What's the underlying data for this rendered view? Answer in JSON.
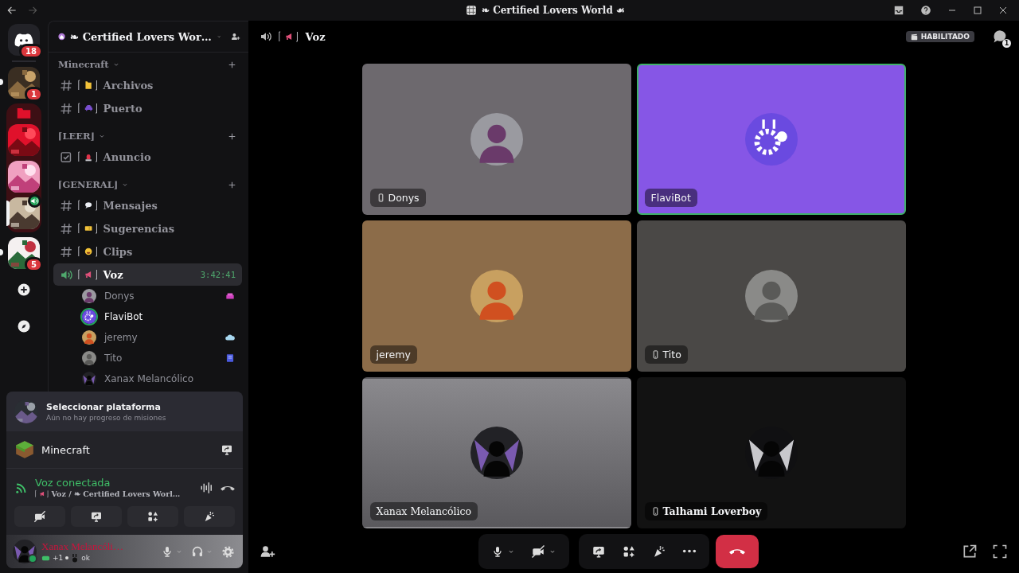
{
  "title_bar": {
    "title": "❧ Certified Lovers World ☙"
  },
  "servers": [
    {
      "kind": "home",
      "badge": "18",
      "selected": false,
      "unread": false,
      "in_voice": false
    },
    {
      "kind": "server",
      "badge": "1",
      "selected": false,
      "unread": true,
      "in_voice": false
    },
    {
      "kind": "folder",
      "children": [
        {
          "kind": "server",
          "selected": false,
          "unread": false,
          "in_voice": false
        },
        {
          "kind": "server",
          "selected": false,
          "unread": false,
          "in_voice": false
        },
        {
          "kind": "server",
          "selected": true,
          "unread": false,
          "in_voice": true
        }
      ]
    },
    {
      "kind": "server",
      "badge": "5",
      "selected": false,
      "unread": true,
      "in_voice": false
    },
    {
      "kind": "add"
    },
    {
      "kind": "discover"
    }
  ],
  "server_header": {
    "name": "❧ Certified Lovers Wor…"
  },
  "categories": [
    {
      "name": "Minecraft",
      "expanded": true,
      "channels": [
        {
          "kind": "text",
          "name": "Archivos",
          "selected": false
        },
        {
          "kind": "text",
          "name": "Puerto",
          "selected": false
        }
      ]
    },
    {
      "name": "⌈LEER⌋",
      "expanded": true,
      "channels": [
        {
          "kind": "announcement",
          "name": "Anuncio",
          "selected": false
        }
      ]
    },
    {
      "name": "⌈GENERAL⌋",
      "expanded": true,
      "channels": [
        {
          "kind": "text",
          "name": "Mensajes",
          "selected": false
        },
        {
          "kind": "text",
          "name": "Sugerencias",
          "selected": false
        },
        {
          "kind": "text",
          "name": "Clips",
          "selected": false
        },
        {
          "kind": "voice",
          "name": "Voz",
          "selected": true,
          "timer": "3:42:41",
          "members": [
            {
              "name": "Donys",
              "speaking": false
            },
            {
              "name": "FlaviBot",
              "speaking": true
            },
            {
              "name": "jeremy",
              "speaking": false
            },
            {
              "name": "Tito",
              "speaking": false
            },
            {
              "name": "Xanax Melancólico",
              "speaking": false
            }
          ]
        }
      ]
    }
  ],
  "panel": {
    "quest": {
      "title": "Seleccionar plataforma",
      "subtitle": "Aún no hay progreso de misiones"
    },
    "game": {
      "name": "Minecraft"
    },
    "voice": {
      "status": "Voz conectada",
      "location": "Voz / ❧ Certified Lovers Worl…"
    },
    "user": {
      "name": "Xanax Melancóli…",
      "extra": "+1",
      "status": "ok"
    }
  },
  "header": {
    "channel": "Voz",
    "badge": "HABILITADO",
    "threads_count": "1"
  },
  "tiles": [
    {
      "name": "Donys",
      "mobile": true,
      "speaking": false,
      "color": "#6d696e"
    },
    {
      "name": "FlaviBot",
      "mobile": false,
      "speaking": true,
      "color": "#8656e6"
    },
    {
      "name": "jeremy",
      "mobile": false,
      "speaking": false,
      "color": "#8c6c49"
    },
    {
      "name": "Tito",
      "mobile": true,
      "speaking": false,
      "color": "#4a4846"
    },
    {
      "name": "Xanax Melancólico",
      "mobile": false,
      "speaking": false,
      "color": "#8a898d"
    },
    {
      "name": "Talhami Loverboy",
      "mobile": true,
      "speaking": false,
      "color": "#121212"
    }
  ]
}
